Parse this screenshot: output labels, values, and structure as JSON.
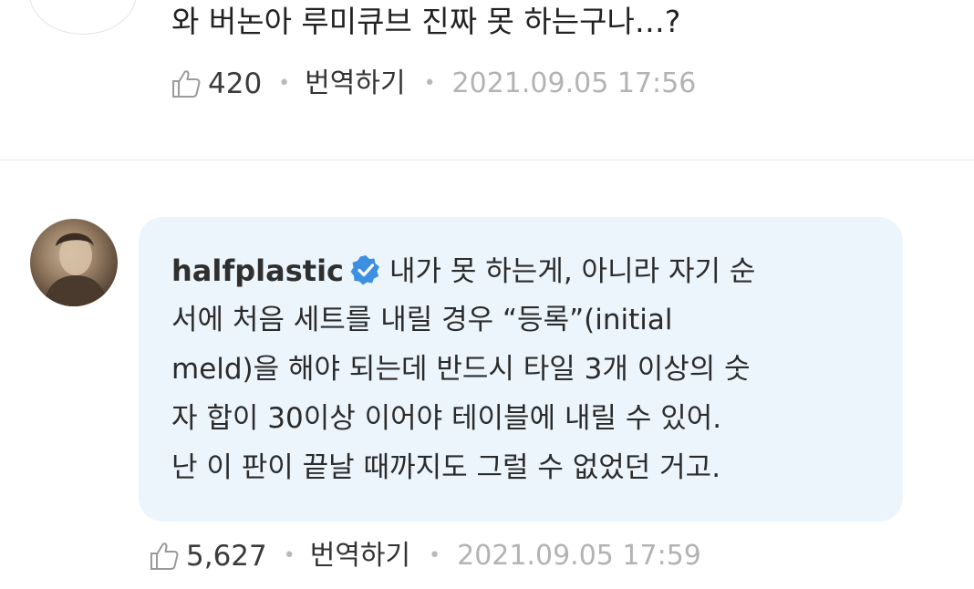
{
  "top_comment": {
    "text": "와 버논아 루미큐브 진짜 못 하는구나…?",
    "likes": "420",
    "translate_label": "번역하기",
    "timestamp": "2021.09.05 17:56"
  },
  "reply": {
    "username": "halfplastic",
    "lines": [
      "내가 못 하는게, 아니라 자기 순",
      "서에 처음 세트를 내릴 경우 “등록”(initial",
      "meld)을 해야 되는데 반드시 타일 3개 이상의 숫",
      "자 합이 30이상 이어야 테이블에 내릴 수 있어.",
      "난 이 판이 끝날 때까지도 그럴 수 없었던 거고."
    ],
    "likes": "5,627",
    "translate_label": "번역하기",
    "timestamp": "2021.09.05 17:59"
  },
  "colors": {
    "bubble_background": "#edf5fc",
    "verified_badge": "#3d8fe0",
    "meta_gray": "#b3b3b3"
  },
  "icons": {
    "like": "thumbs-up-outline-icon",
    "verified": "verified-badge-icon"
  }
}
